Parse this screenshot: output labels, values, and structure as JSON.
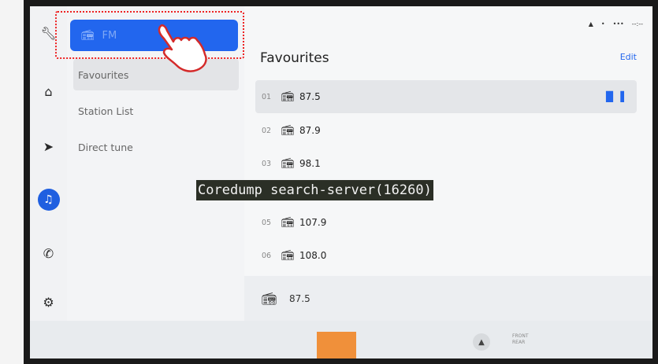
{
  "source_button": {
    "label": "FM"
  },
  "menu": {
    "items": [
      {
        "label": "Favourites",
        "selected": true
      },
      {
        "label": "Station List",
        "selected": false
      },
      {
        "label": "Direct tune",
        "selected": false
      }
    ]
  },
  "rail": {
    "icons": [
      "wrench-icon",
      "home-icon",
      "navigation-icon",
      "music-icon",
      "phone-icon",
      "settings-icon"
    ],
    "active": "music-icon"
  },
  "content": {
    "title": "Favourites",
    "edit_label": "Edit",
    "stations": [
      {
        "num": "01",
        "freq": "87.5",
        "playing": true
      },
      {
        "num": "02",
        "freq": "87.9",
        "playing": false
      },
      {
        "num": "03",
        "freq": "98.1",
        "playing": false
      },
      {
        "num": "05",
        "freq": "107.9",
        "playing": false
      },
      {
        "num": "06",
        "freq": "108.0",
        "playing": false
      }
    ],
    "now_playing": {
      "freq": "87.5"
    }
  },
  "bottom": {
    "front_label": "FRONT",
    "rear_label": "REAR"
  },
  "overlay": {
    "text": "Coredump search-server(16260)"
  },
  "colors": {
    "accent": "#2266ee",
    "highlight_box": "#e22222",
    "orange_block": "#f0903a"
  }
}
